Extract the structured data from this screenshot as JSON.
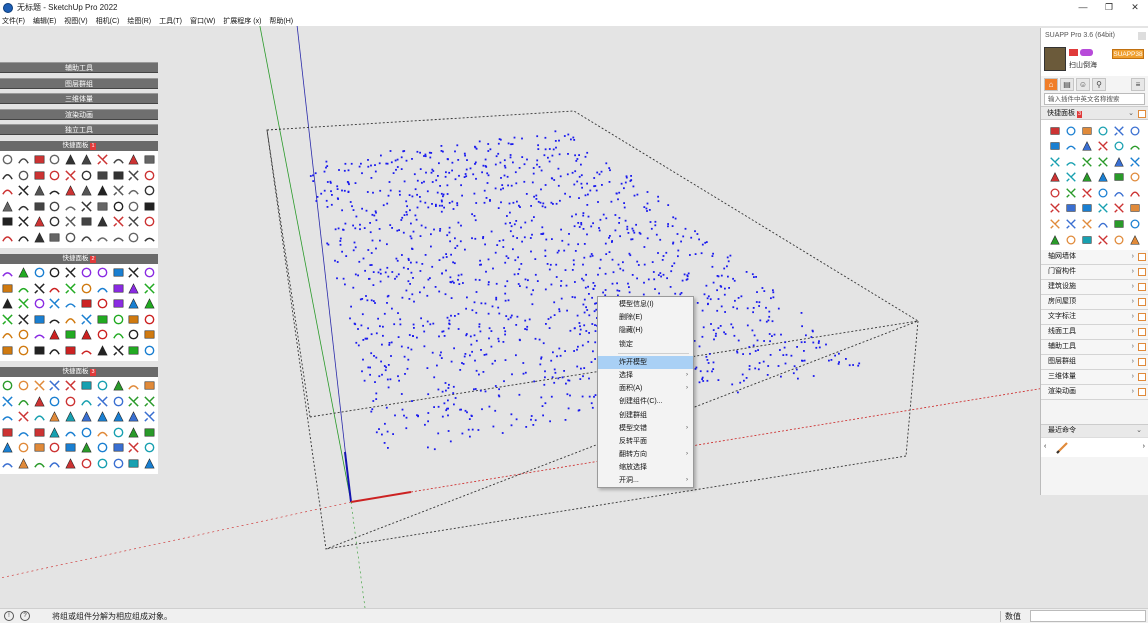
{
  "window": {
    "title": "无标题 - SketchUp Pro 2022",
    "min_label": "—",
    "max_label": "❐",
    "close_label": "✕"
  },
  "menu": [
    "文件(F)",
    "编辑(E)",
    "视图(V)",
    "相机(C)",
    "绘图(R)",
    "工具(T)",
    "窗口(W)",
    "扩展程序 (x)",
    "帮助(H)"
  ],
  "left_tray": {
    "buttons": [
      "辅助工具",
      "图层群组",
      "三维体量",
      "渲染动画",
      "独立工具"
    ],
    "quick_panels": [
      {
        "label": "快捷面板",
        "badge": "1",
        "rows": 6
      },
      {
        "label": "快捷面板",
        "badge": "2",
        "rows": 6
      },
      {
        "label": "快捷面板",
        "badge": "3",
        "rows": 6
      }
    ]
  },
  "context_menu": {
    "items": [
      {
        "label": "模型信息(I)",
        "submenu": false,
        "highlighted": false,
        "separator_after": false
      },
      {
        "label": "删除(E)",
        "submenu": false,
        "highlighted": false,
        "separator_after": false
      },
      {
        "label": "隐藏(H)",
        "submenu": false,
        "highlighted": false,
        "separator_after": false
      },
      {
        "label": "锁定",
        "submenu": false,
        "highlighted": false,
        "separator_after": true
      },
      {
        "label": "炸开模型",
        "submenu": false,
        "highlighted": true,
        "separator_after": false
      },
      {
        "label": "选择",
        "submenu": true,
        "highlighted": false,
        "separator_after": false
      },
      {
        "label": "面积(A)",
        "submenu": true,
        "highlighted": false,
        "separator_after": false
      },
      {
        "label": "创建组件(C)...",
        "submenu": false,
        "highlighted": false,
        "separator_after": false
      },
      {
        "label": "创建群组",
        "submenu": false,
        "highlighted": false,
        "separator_after": false
      },
      {
        "label": "模型交错",
        "submenu": true,
        "highlighted": false,
        "separator_after": false
      },
      {
        "label": "反转平面",
        "submenu": false,
        "highlighted": false,
        "separator_after": false
      },
      {
        "label": "翻转方向",
        "submenu": true,
        "highlighted": false,
        "separator_after": false
      },
      {
        "label": "缩放选择",
        "submenu": false,
        "highlighted": false,
        "separator_after": false
      },
      {
        "label": "开洞...",
        "submenu": true,
        "highlighted": false,
        "separator_after": false
      }
    ]
  },
  "suapp": {
    "title": "SUAPP Pro 3.6 (64bit)",
    "user_name": "扫山倒海",
    "suapp_button": "SUAPP38",
    "search_placeholder": "输入插件中英文名称搜索",
    "quick_panel_label": "快捷面板",
    "quick_panel_badge": "3",
    "categories": [
      "轴网墙体",
      "门窗构件",
      "建筑设施",
      "房间屋顶",
      "文字标注",
      "线面工具",
      "辅助工具",
      "图层群组",
      "三维体量",
      "渲染动画"
    ],
    "recent_label": "最近命令",
    "recent_left": "‹",
    "recent_right": "›"
  },
  "status": {
    "message": "将组或组件分解为相应组成对象。",
    "vcb_label": "数值",
    "vcb_value": ""
  },
  "colors": {
    "axis_red": "#cc2222",
    "axis_green": "#2a9a2a",
    "axis_blue": "#2a2aaa",
    "points": "#1a1aee",
    "highlight": "#a9d0f5",
    "accent_orange": "#f07e2a"
  }
}
